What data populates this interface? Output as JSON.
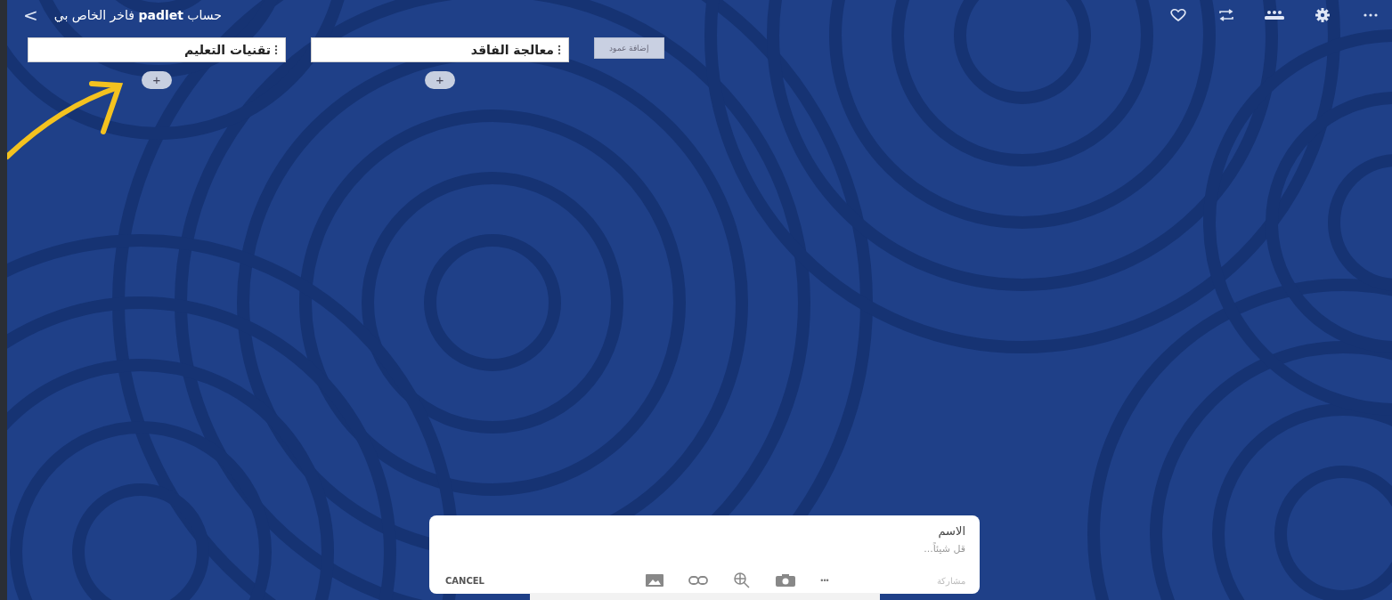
{
  "header": {
    "back": "<",
    "title": "حساب **padlet** فاخر الخاص بي"
  },
  "columns": [
    {
      "title": "معالجة الفاقد",
      "add": "+"
    },
    {
      "title": "تقنيات التعليم",
      "add": "+"
    }
  ],
  "add_column": {
    "label": "إضافة عمود"
  },
  "composer": {
    "title_placeholder": "الاسم",
    "body_placeholder": "قل شيئاً...",
    "cancel": "CANCEL",
    "more": "•••",
    "publish": {
      "label": "مشاركة",
      "disabled": true
    }
  }
}
